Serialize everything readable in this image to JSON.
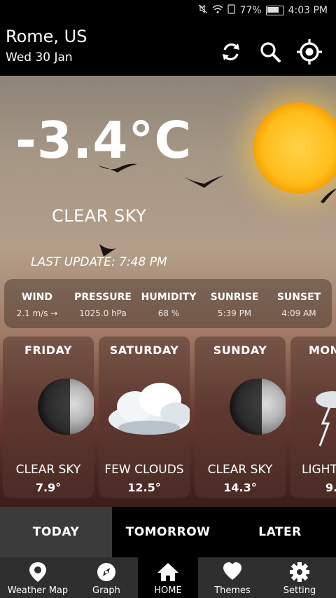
{
  "status": {
    "battery_pct": "77%",
    "time": "4:03 PM"
  },
  "header": {
    "city": "Rome, US",
    "date": "Wed 30 Jan"
  },
  "hero": {
    "temperature": "-3.4°C",
    "condition": "CLEAR SKY",
    "last_update": "LAST UPDATE: 7:48 PM"
  },
  "stats": [
    {
      "label": "WIND",
      "value": "2.1 m/s →"
    },
    {
      "label": "PRESSURE",
      "value": "1025.0 hPa"
    },
    {
      "label": "HUMIDITY",
      "value": "68 %"
    },
    {
      "label": "SUNRISE",
      "value": "5:39 PM"
    },
    {
      "label": "SUNSET",
      "value": "4:09 AM"
    }
  ],
  "forecast": [
    {
      "day": "FRIDAY",
      "condition": "CLEAR SKY",
      "temp": "7.9°",
      "icon": "moon-icon"
    },
    {
      "day": "SATURDAY",
      "condition": "FEW CLOUDS",
      "temp": "12.5°",
      "icon": "cloud-icon"
    },
    {
      "day": "SUNDAY",
      "condition": "CLEAR SKY",
      "temp": "14.3°",
      "icon": "moon-icon"
    },
    {
      "day": "MON",
      "condition": "LIGHT",
      "temp": "9.",
      "icon": "lightning-icon"
    }
  ],
  "tabs": [
    {
      "label": "TODAY"
    },
    {
      "label": "TOMORROW"
    },
    {
      "label": "LATER"
    }
  ],
  "nav": [
    {
      "label": "Weather Map",
      "icon": "map-pin-icon"
    },
    {
      "label": "Graph",
      "icon": "compass-icon"
    },
    {
      "label": "HOME",
      "icon": "home-icon"
    },
    {
      "label": "Themes",
      "icon": "heart-icon"
    },
    {
      "label": "Setting",
      "icon": "gear-icon"
    }
  ],
  "colors": {
    "sun": "#ffbd1a",
    "active_tab_bg": "#3b3b3b",
    "nav_bg": "#2f2f2f"
  }
}
